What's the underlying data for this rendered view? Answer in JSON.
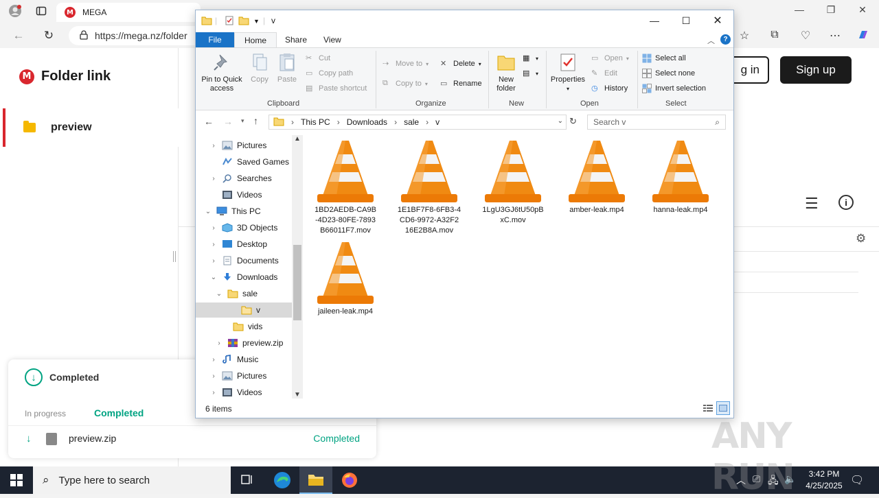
{
  "browser": {
    "tab_title": "MEGA",
    "url": "https://mega.nz/folder"
  },
  "mega": {
    "logo_text": "Folder link",
    "logo_mark": "M",
    "sidebar_folder": "preview",
    "login_label": "g in",
    "signup_label": "Sign up",
    "transfers": {
      "header": "Completed",
      "tab_in_progress": "In progress",
      "tab_completed": "Completed",
      "items": [
        {
          "name": "preview.zip",
          "status": "Completed"
        }
      ]
    }
  },
  "explorer": {
    "title": "v",
    "tabs": {
      "file": "File",
      "home": "Home",
      "share": "Share",
      "view": "View"
    },
    "ribbon": {
      "clipboard": {
        "label": "Clipboard",
        "pin": "Pin to Quick access",
        "copy": "Copy",
        "paste": "Paste",
        "cut": "Cut",
        "copy_path": "Copy path",
        "paste_shortcut": "Paste shortcut"
      },
      "organize": {
        "label": "Organize",
        "move_to": "Move to",
        "copy_to": "Copy to",
        "delete": "Delete",
        "rename": "Rename"
      },
      "new": {
        "label": "New",
        "new_folder": "New folder"
      },
      "open": {
        "label": "Open",
        "properties": "Properties",
        "open": "Open",
        "edit": "Edit",
        "history": "History"
      },
      "select": {
        "label": "Select",
        "select_all": "Select all",
        "select_none": "Select none",
        "invert": "Invert selection"
      }
    },
    "breadcrumb": [
      "This PC",
      "Downloads",
      "sale",
      "v"
    ],
    "search_placeholder": "Search v",
    "nav": [
      {
        "label": "Pictures"
      },
      {
        "label": "Saved Games"
      },
      {
        "label": "Searches"
      },
      {
        "label": "Videos"
      },
      {
        "label": "This PC"
      },
      {
        "label": "3D Objects"
      },
      {
        "label": "Desktop"
      },
      {
        "label": "Documents"
      },
      {
        "label": "Downloads"
      },
      {
        "label": "sale"
      },
      {
        "label": "v"
      },
      {
        "label": "vids"
      },
      {
        "label": "preview.zip"
      },
      {
        "label": "Music"
      },
      {
        "label": "Pictures"
      },
      {
        "label": "Videos"
      }
    ],
    "files": [
      {
        "name_lines": [
          "1BD2AEDB-CA9B",
          "-4D23-80FE-7893",
          "B66011F7.mov"
        ]
      },
      {
        "name_lines": [
          "1E1BF7F8-6FB3-4",
          "CD6-9972-A32F2",
          "16E2B8A.mov"
        ]
      },
      {
        "name_lines": [
          "1LgU3GJ6tU50pB",
          "xC.mov"
        ]
      },
      {
        "name_lines": [
          "amber-leak.mp4"
        ]
      },
      {
        "name_lines": [
          "hanna-leak.mp4"
        ]
      },
      {
        "name_lines": [
          "jaileen-leak.mp4"
        ]
      }
    ],
    "status_count": "6 items"
  },
  "taskbar": {
    "search_placeholder": "Type here to search",
    "time": "3:42 PM",
    "date": "4/25/2025"
  },
  "watermark": "ANY RUN"
}
